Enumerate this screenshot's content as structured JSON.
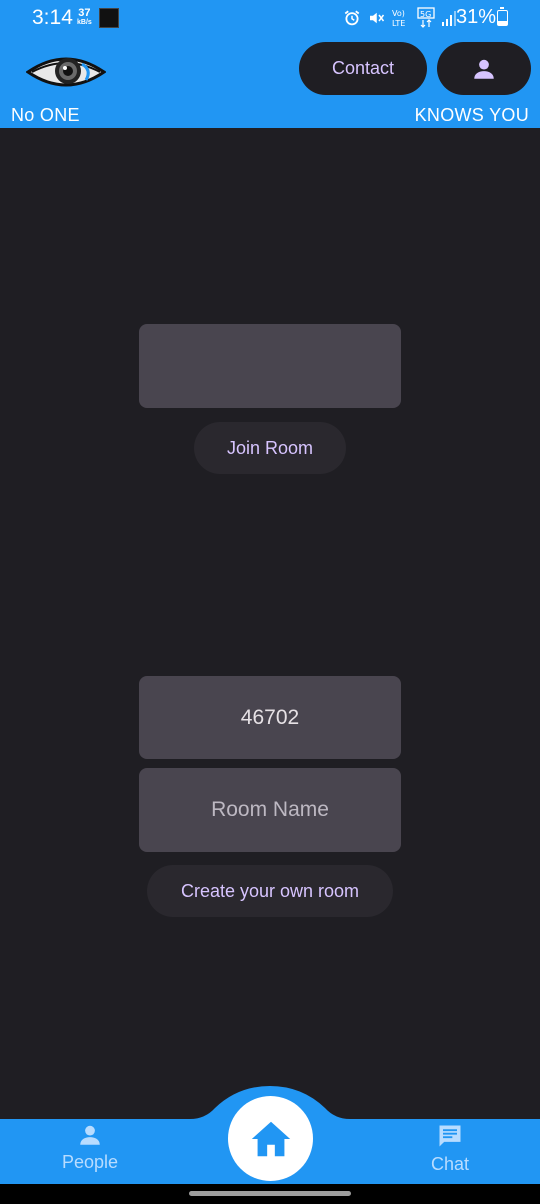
{
  "status_bar": {
    "time": "3:14",
    "net_speed_value": "37",
    "net_speed_unit": "kB/s",
    "battery_percent": "31%",
    "icons": [
      "alarm-icon",
      "mute-icon",
      "volte-icon",
      "5g-icon",
      "signal-icon",
      "battery-icon"
    ]
  },
  "header": {
    "logo": "eye-logo",
    "contact_label": "Contact",
    "profile_icon": "person-icon",
    "tagline_left": "No ONE",
    "tagline_right": "KNOWS YOU",
    "background_color": "#2196f3"
  },
  "join": {
    "room_input_value": "",
    "join_button_label": "Join Room"
  },
  "create": {
    "room_id_value": "46702",
    "room_name_placeholder": "Room Name",
    "create_button_label": "Create your own room"
  },
  "bottom_nav": {
    "people_label": "People",
    "home_icon": "home-icon",
    "chat_label": "Chat"
  },
  "colors": {
    "background": "#1f1e23",
    "accent": "#d7c4ff",
    "field": "#49454f"
  }
}
